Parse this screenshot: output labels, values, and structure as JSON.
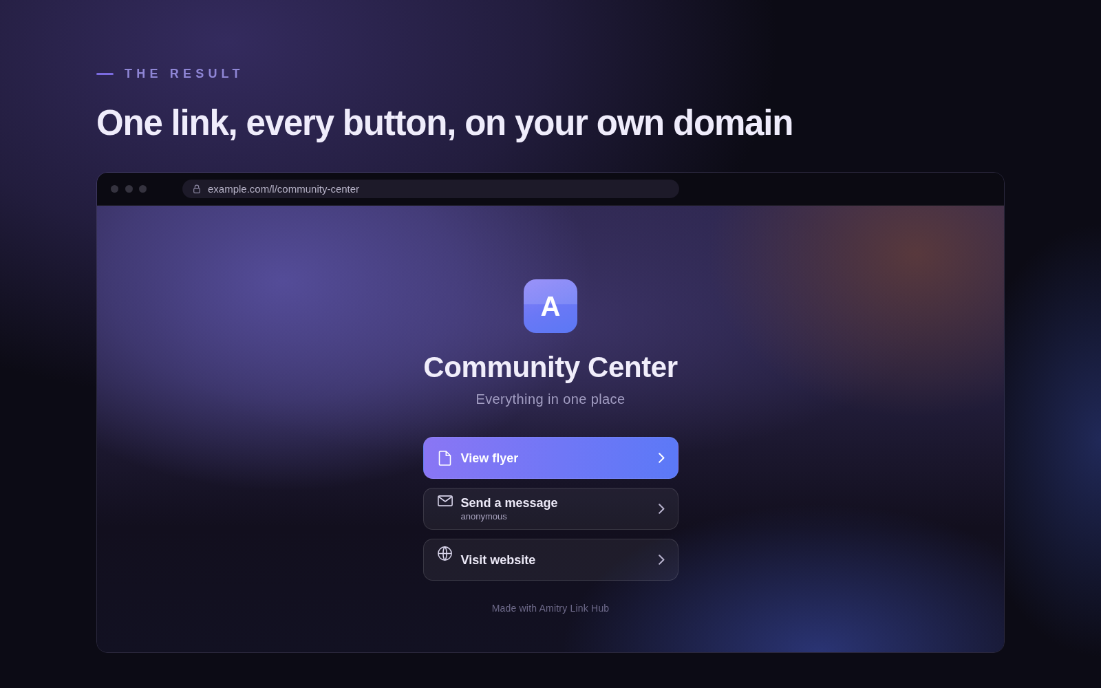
{
  "eyebrow": {
    "label": "THE RESULT"
  },
  "headline": "One link, every button, on your own domain",
  "browser": {
    "url": "example.com/l/community-center"
  },
  "profile": {
    "avatar_letter": "A",
    "name": "Community Center",
    "tagline": "Everything in one place"
  },
  "links": [
    {
      "title": "View flyer",
      "highlighted": true
    },
    {
      "title": "Send a message",
      "subtitle": "anonymous",
      "highlighted": false
    },
    {
      "title": "Visit website",
      "highlighted": false
    }
  ],
  "footer": "Made with Amitry Link Hub"
}
